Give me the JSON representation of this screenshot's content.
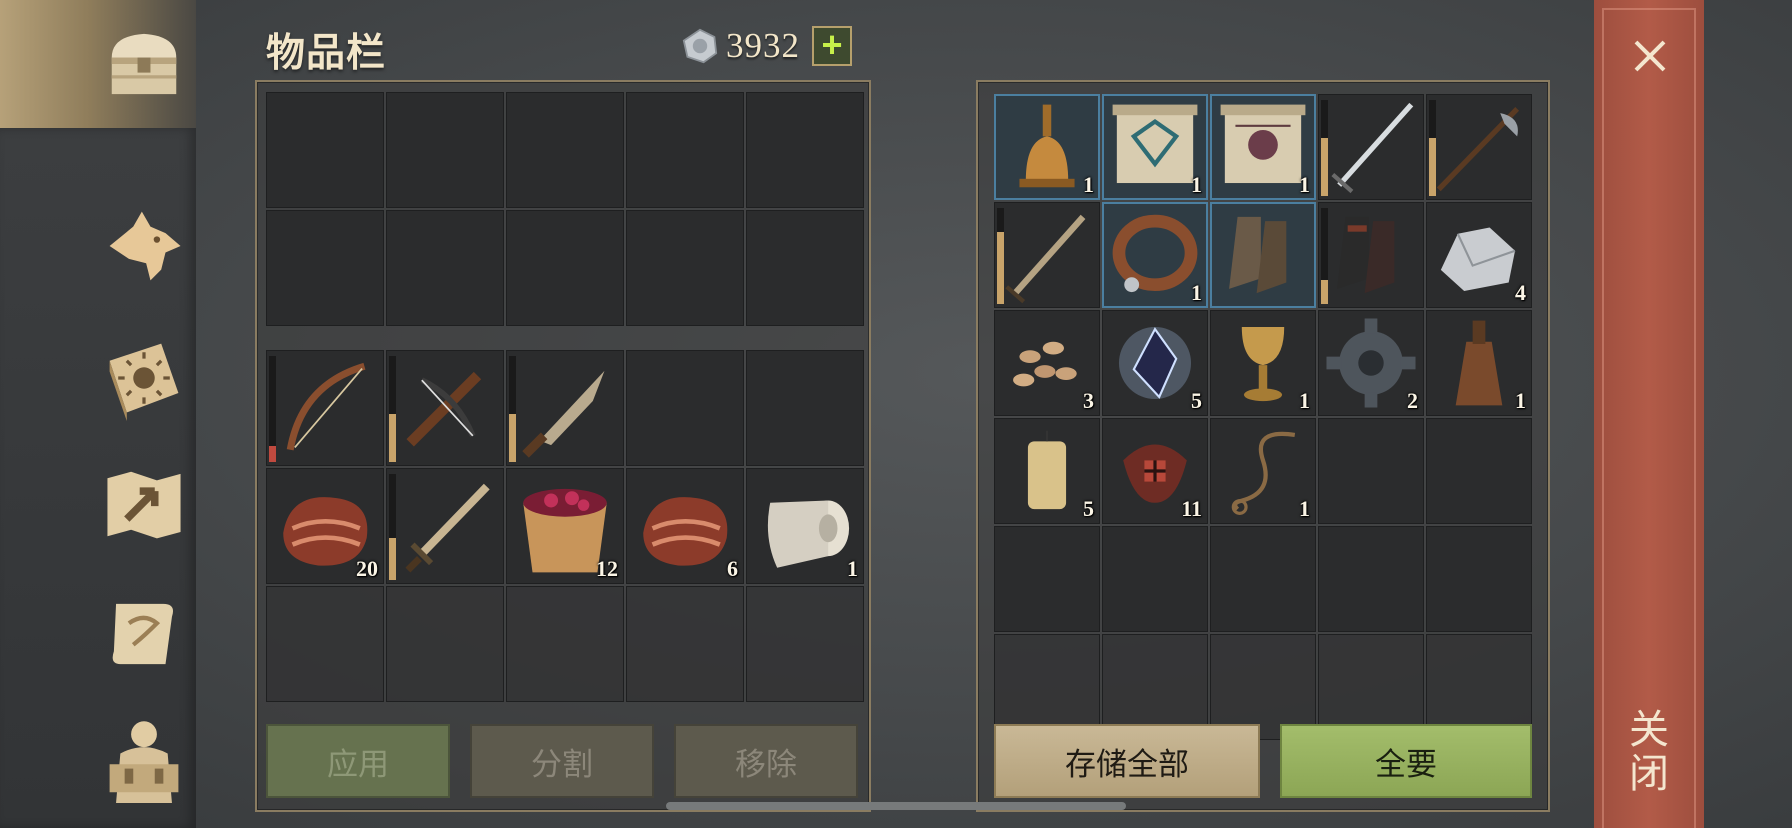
{
  "header": {
    "title": "物品栏",
    "coins": "3932",
    "add_label": "+"
  },
  "nav": [
    "chest",
    "wolf",
    "sun-book",
    "map",
    "scroll",
    "backpack"
  ],
  "player_inventory": {
    "storage_rows": 2,
    "items": [
      {
        "icon": "bow-icon",
        "qty": "",
        "durability": 0.15,
        "dur_color": "red"
      },
      {
        "icon": "crossbow-icon",
        "qty": "",
        "durability": 0.45
      },
      {
        "icon": "machete-icon",
        "qty": "",
        "durability": 0.45
      },
      null,
      null,
      {
        "icon": "meat-icon",
        "qty": "20"
      },
      {
        "icon": "sword-icon",
        "qty": "",
        "durability": 0.4
      },
      {
        "icon": "berry-bucket-icon",
        "qty": "12"
      },
      {
        "icon": "meat-icon",
        "qty": "6"
      },
      {
        "icon": "cloth-roll-icon",
        "qty": "1"
      }
    ]
  },
  "chest_inventory": {
    "items": [
      {
        "icon": "bell-icon",
        "qty": "1",
        "blue": true
      },
      {
        "icon": "blueprint-scroll-icon",
        "qty": "1",
        "blue": true
      },
      {
        "icon": "recipe-scroll-icon",
        "qty": "1",
        "blue": true
      },
      {
        "icon": "longsword-icon",
        "qty": "",
        "durability": 0.6
      },
      {
        "icon": "halberd-icon",
        "qty": "",
        "durability": 0.6
      },
      {
        "icon": "steel-sword-icon",
        "qty": "",
        "durability": 0.75
      },
      {
        "icon": "collar-icon",
        "qty": "1",
        "blue": true
      },
      {
        "icon": "boots-icon",
        "qty": "",
        "blue": true
      },
      {
        "icon": "dark-boots-icon",
        "qty": "",
        "durability": 0.25
      },
      {
        "icon": "iron-ore-icon",
        "qty": "4"
      },
      {
        "icon": "seeds-icon",
        "qty": "3"
      },
      {
        "icon": "crystal-icon",
        "qty": "5"
      },
      {
        "icon": "goblet-icon",
        "qty": "1"
      },
      {
        "icon": "gear-icon",
        "qty": "2"
      },
      {
        "icon": "bottle-icon",
        "qty": "1"
      },
      {
        "icon": "candle-icon",
        "qty": "5"
      },
      {
        "icon": "remains-icon",
        "qty": "11"
      },
      {
        "icon": "rope-icon",
        "qty": "1"
      }
    ]
  },
  "buttons": {
    "apply": "应用",
    "split": "分割",
    "remove": "移除",
    "store_all": "存储全部",
    "take_all": "全要",
    "close": "关闭"
  },
  "colors": {
    "close_bar": "#b25b48",
    "take_all": "#9cb762",
    "store_all": "#c2b08b",
    "durability": "#c9a46a"
  }
}
